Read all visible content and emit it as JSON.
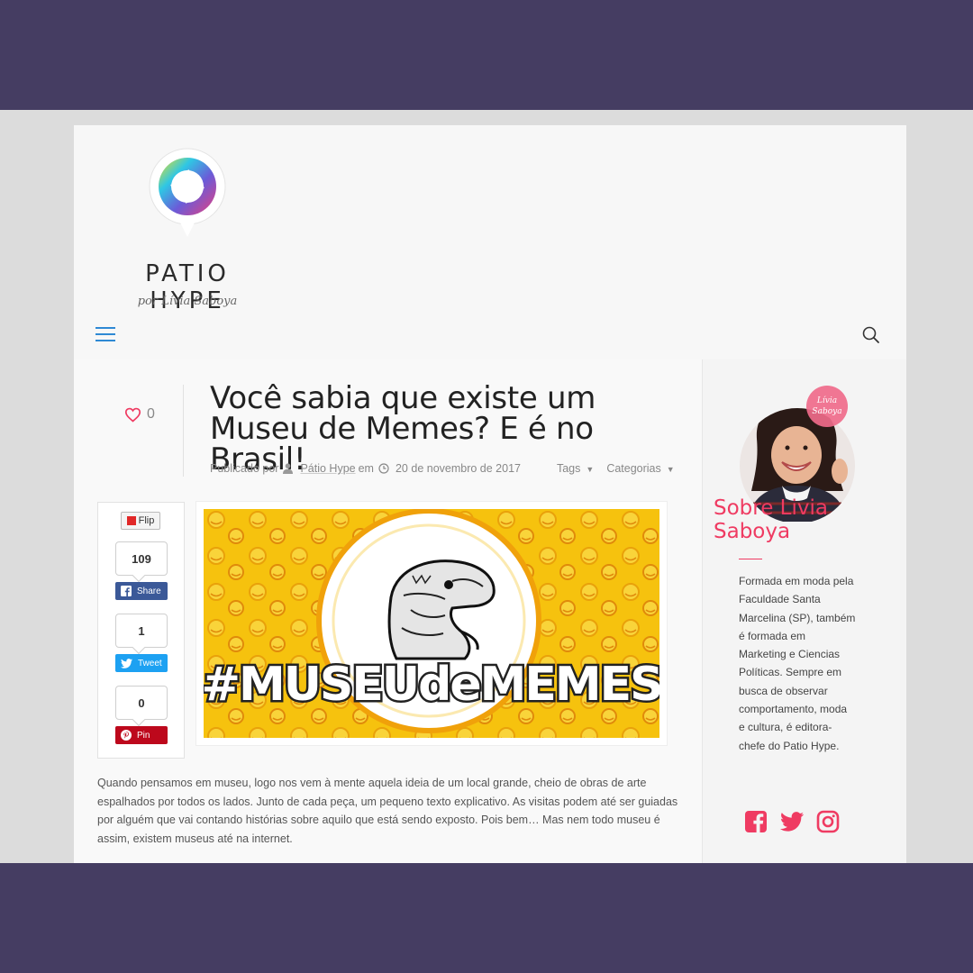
{
  "brand": {
    "name": "PATIO HYPE",
    "signature": "por Lívia Saboya"
  },
  "header": {
    "menu_icon": "hamburger-icon",
    "search_icon": "search-icon"
  },
  "post": {
    "likes": "0",
    "title": "Você sabia que existe um Museu de Memes? E é no Brasil!",
    "meta": {
      "published_by": "Publicado por",
      "author": "Pátio Hype",
      "at": "em",
      "date": "20 de novembro de 2017",
      "tags": "Tags",
      "categories": "Categorias"
    },
    "image_text": "#MUSEUdeMEMES",
    "body": "Quando pensamos em museu, logo nos vem à mente aquela ideia de um local grande,  cheio de obras de arte espalhados por todos os lados. Junto de cada peça, um pequeno texto explicativo. As visitas podem até ser guiadas por alguém que vai contando histórias sobre aquilo que está sendo exposto. Pois bem… Mas nem todo museu é assim, existem museus até na internet."
  },
  "share": {
    "flip_label": "Flip",
    "facebook": {
      "count": "109",
      "label": "Share",
      "color": "#3b5998"
    },
    "twitter": {
      "count": "1",
      "label": "Tweet",
      "color": "#1da1f2"
    },
    "pinterest": {
      "count": "0",
      "label": "Pin",
      "color": "#bd081c"
    }
  },
  "sidebar": {
    "badge_line1": "Lívia",
    "badge_line2": "Saboya",
    "about_title_line1": "Sobre Livia",
    "about_title_line2": "Saboya",
    "about_text": "Formada em moda pela Faculdade Santa Marcelina (SP), também é formada em Marketing e Ciencias Políticas. Sempre em busca de observar comportamento, moda e cultura, é editora-chefe do Patio Hype.",
    "socials": [
      "facebook-icon",
      "twitter-icon",
      "instagram-icon"
    ]
  },
  "colors": {
    "accent": "#ef3b62",
    "frame": "#453d62",
    "link_blue": "#2e89d4"
  }
}
